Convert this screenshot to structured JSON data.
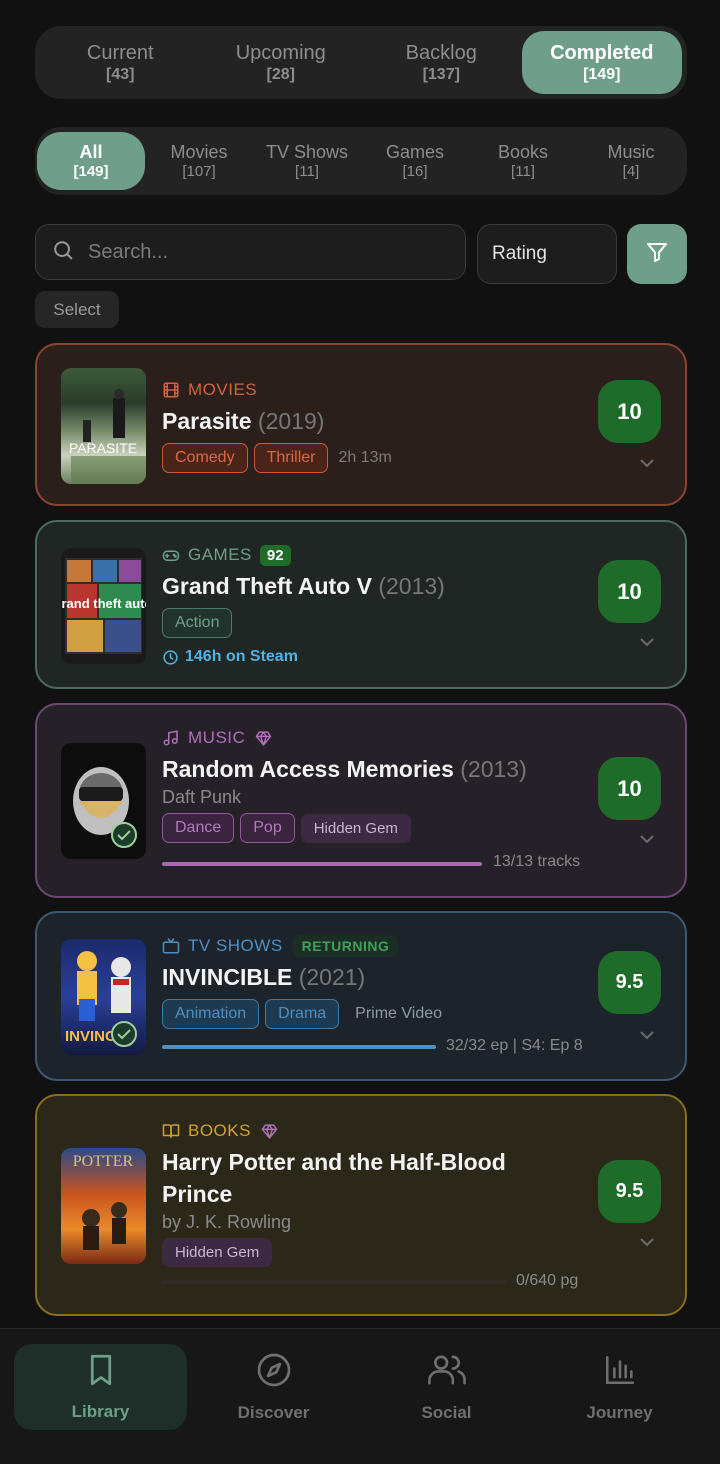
{
  "status_tabs": [
    {
      "label": "Current",
      "count": "[43]"
    },
    {
      "label": "Upcoming",
      "count": "[28]"
    },
    {
      "label": "Backlog",
      "count": "[137]"
    },
    {
      "label": "Completed",
      "count": "[149]"
    }
  ],
  "category_tabs": [
    {
      "label": "All",
      "count": "[149]"
    },
    {
      "label": "Movies",
      "count": "[107]"
    },
    {
      "label": "TV Shows",
      "count": "[11]"
    },
    {
      "label": "Games",
      "count": "[16]"
    },
    {
      "label": "Books",
      "count": "[11]"
    },
    {
      "label": "Music",
      "count": "[4]"
    }
  ],
  "search": {
    "placeholder": "Search..."
  },
  "sort": {
    "value": "Rating"
  },
  "select_label": "Select",
  "items": [
    {
      "category": "MOVIES",
      "category_icon": "film-icon",
      "accent": "#d0643f",
      "title": "Parasite",
      "year": "(2019)",
      "tags": [
        "Comedy",
        "Thriller"
      ],
      "meta": "2h 13m",
      "score": "10",
      "cover_text": "PARASITE"
    },
    {
      "category": "GAMES",
      "category_icon": "gamepad-icon",
      "accent": "#6f9e8a",
      "badge": "92",
      "title": "Grand Theft Auto V",
      "year": "(2013)",
      "tags": [
        "Action"
      ],
      "playtime": "146h on Steam",
      "score": "10",
      "cover_text": "grand theft auto"
    },
    {
      "category": "MUSIC",
      "category_icon": "music-note-icon",
      "accent": "#b06fb8",
      "title": "Random Access Memories",
      "year": "(2013)",
      "artist": "Daft Punk",
      "tags": [
        "Dance",
        "Pop"
      ],
      "gem_tag": "Hidden Gem",
      "progress": "13/13 tracks",
      "progress_fraction": 1.0,
      "score": "10"
    },
    {
      "category": "TV SHOWS",
      "category_icon": "tv-icon",
      "accent": "#4f8fc0",
      "status_badge": "RETURNING",
      "title": "INVINCIBLE",
      "year": "(2021)",
      "tags": [
        "Animation",
        "Drama"
      ],
      "meta": "Prime Video",
      "progress": "32/32 ep | S4: Ep 8",
      "progress_fraction": 1.0,
      "score": "9.5",
      "cover_text": "INVINC"
    },
    {
      "category": "BOOKS",
      "category_icon": "book-icon",
      "accent": "#d1a22c",
      "title": "Harry Potter and the Half-Blood Prince",
      "author": "by J. K. Rowling",
      "gem_tag": "Hidden Gem",
      "progress": "0/640 pg",
      "progress_fraction": 0.0,
      "score": "9.5",
      "cover_text": "POTTER"
    }
  ],
  "bottom_nav": [
    {
      "label": "Library",
      "icon": "bookmark-icon"
    },
    {
      "label": "Discover",
      "icon": "compass-icon"
    },
    {
      "label": "Social",
      "icon": "users-icon"
    },
    {
      "label": "Journey",
      "icon": "bar-chart-icon"
    }
  ],
  "colors": {
    "accent": "#6f9e8a",
    "score_bg": "#1f6b2a",
    "background": "#111111"
  }
}
